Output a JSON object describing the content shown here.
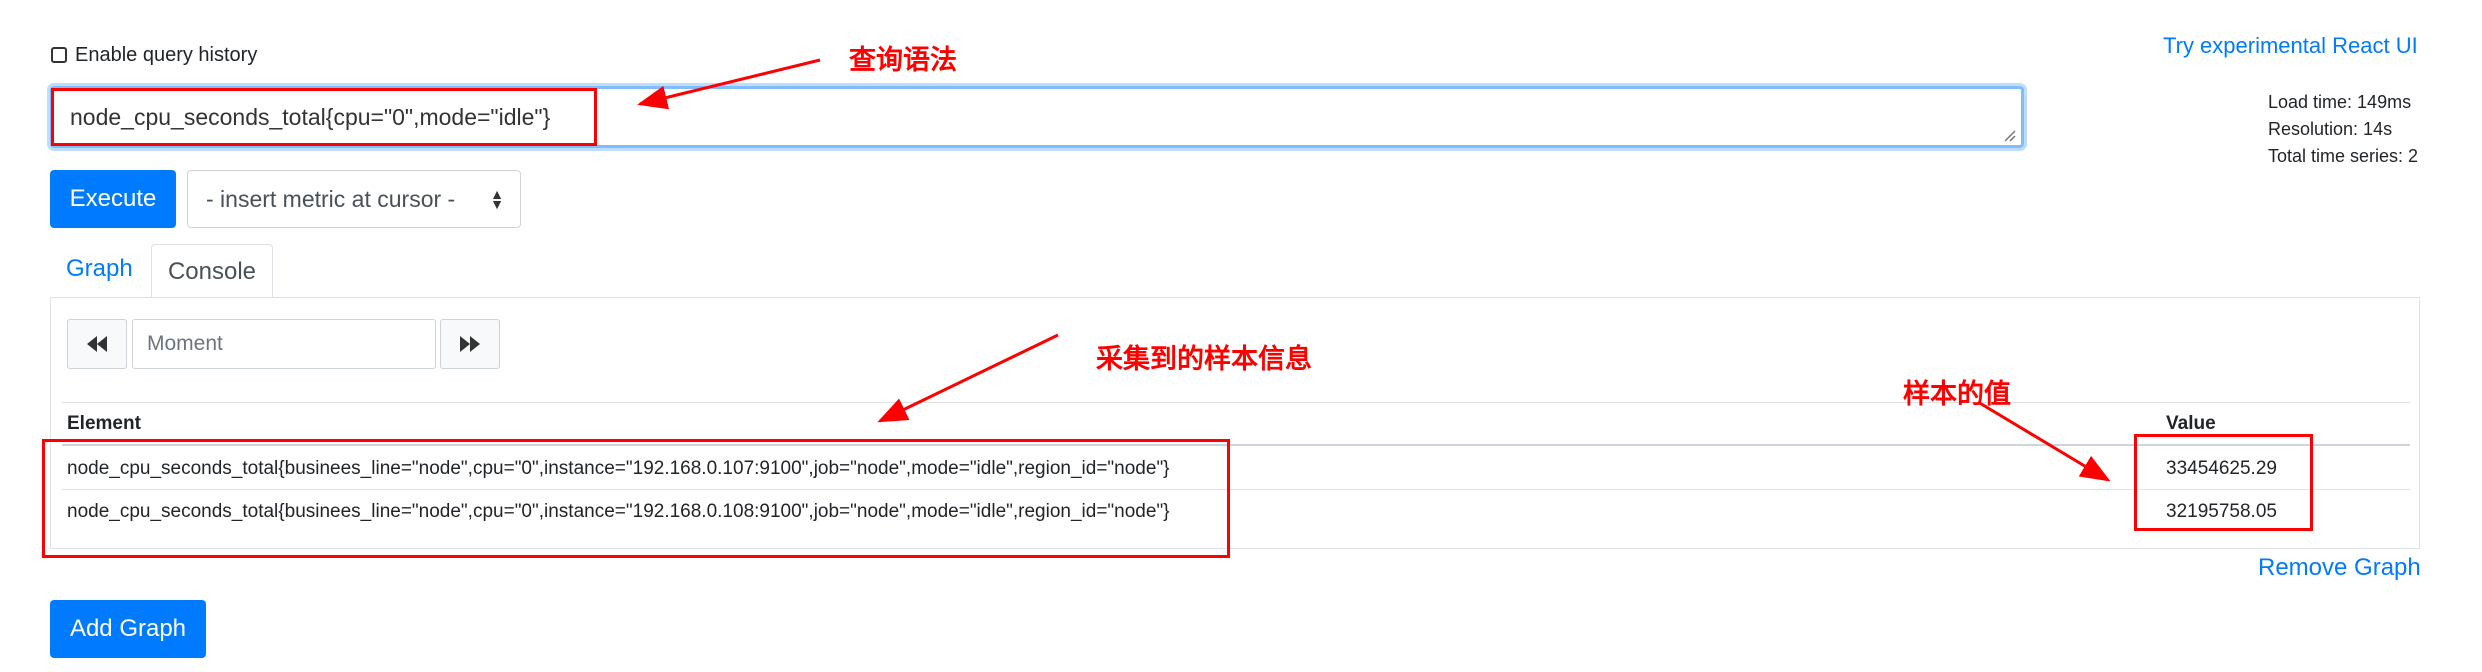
{
  "header": {
    "history_label": "Enable query history",
    "react_link": "Try experimental React UI"
  },
  "stats": {
    "load_time": "Load time: 149ms",
    "resolution": "Resolution: 14s",
    "total_series": "Total time series: 2"
  },
  "query": {
    "value": "node_cpu_seconds_total{cpu=\"0\",mode=\"idle\"}"
  },
  "controls": {
    "execute_label": "Execute",
    "metric_select": "- insert metric at cursor -"
  },
  "tabs": [
    {
      "label": "Graph",
      "active": false
    },
    {
      "label": "Console",
      "active": true
    }
  ],
  "console": {
    "moment_placeholder": "Moment",
    "columns": [
      "Element",
      "Value"
    ],
    "rows": [
      {
        "element": "node_cpu_seconds_total{businees_line=\"node\",cpu=\"0\",instance=\"192.168.0.107:9100\",job=\"node\",mode=\"idle\",region_id=\"node\"}",
        "value": "33454625.29"
      },
      {
        "element": "node_cpu_seconds_total{businees_line=\"node\",cpu=\"0\",instance=\"192.168.0.108:9100\",job=\"node\",mode=\"idle\",region_id=\"node\"}",
        "value": "32195758.05"
      }
    ]
  },
  "footer": {
    "remove_graph": "Remove Graph",
    "add_graph": "Add Graph"
  },
  "annotations": {
    "query_syntax": "查询语法",
    "sample_info": "采集到的样本信息",
    "sample_value": "样本的值"
  },
  "icons": {
    "back": "fast-backward-icon",
    "forward": "fast-forward-icon",
    "select_caret": "sort-caret-icon",
    "resize": "resize-grip-icon"
  },
  "colors": {
    "primary": "#007bff",
    "annotation": "#ff0000",
    "focus_border": "#80bdff"
  }
}
